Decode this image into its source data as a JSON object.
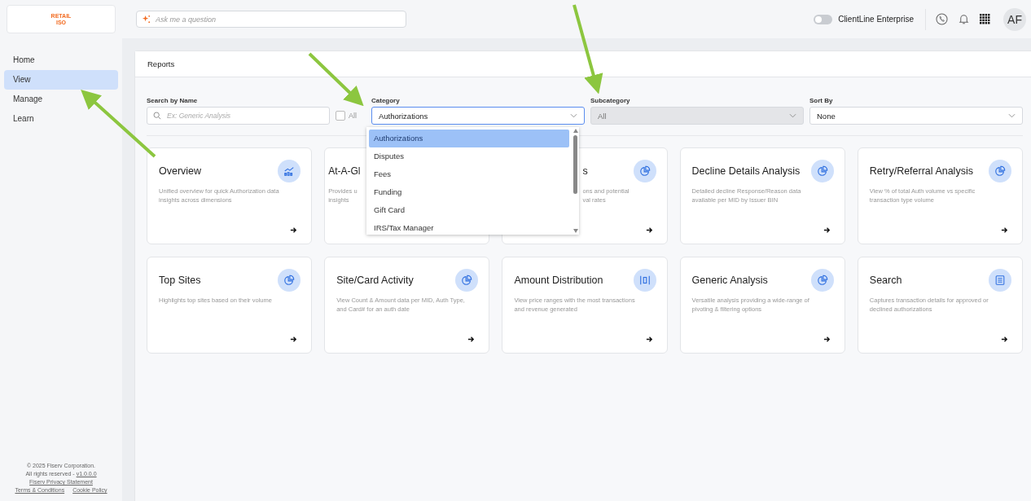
{
  "logo": {
    "line_1": "RETAIL",
    "line_2": "ISO"
  },
  "ask": {
    "placeholder": "Ask me a question"
  },
  "header": {
    "toggle": {
      "label": "ClientLine Enterprise",
      "on": false
    },
    "avatar": "AF"
  },
  "sidebar": {
    "items": [
      {
        "label": "Home",
        "selected": false
      },
      {
        "label": "View",
        "selected": true
      },
      {
        "label": "Manage",
        "selected": false
      },
      {
        "label": "Learn",
        "selected": false
      }
    ],
    "footer": {
      "copyright": "© 2025 Fiserv Corporation.",
      "rights": "All rights reserved -",
      "version": "v1.0.0.0",
      "links": [
        "Fiserv Privacy Statement",
        "Terms & Conditions",
        "Cookie Policy"
      ]
    }
  },
  "panel": {
    "title": "Reports"
  },
  "filters": {
    "search": {
      "label": "Search by Name",
      "placeholder": "Ex: Generic Analysis"
    },
    "all": {
      "label": "All",
      "checked": false
    },
    "category": {
      "label": "Category",
      "value": "Authorizations",
      "disabled": false
    },
    "subcategory": {
      "label": "Subcategory",
      "value": "All",
      "disabled": true
    },
    "sort": {
      "label": "Sort By",
      "value": "None",
      "disabled": false
    }
  },
  "category_dropdown": {
    "options": [
      {
        "label": "Authorizations",
        "selected": true
      },
      {
        "label": "Disputes",
        "selected": false
      },
      {
        "label": "Fees",
        "selected": false
      },
      {
        "label": "Funding",
        "selected": false
      },
      {
        "label": "Gift Card",
        "selected": false
      },
      {
        "label": "IRS/Tax Manager",
        "selected": false
      }
    ]
  },
  "cards": [
    {
      "title": "Overview",
      "description": [
        "Unified overview for quick Authorization data",
        "insights across dimensions"
      ]
    },
    {
      "title": "At-A-Gl",
      "description": [
        "Provides u",
        "insights"
      ]
    },
    {
      "title": "s",
      "description": [
        "ons and potential",
        "val rates"
      ]
    },
    {
      "title": "Decline Details Analysis",
      "description": [
        "Detailed decline Response/Reason data",
        "available per MID by Issuer BIN"
      ]
    },
    {
      "title": "Retry/Referral Analysis",
      "description": [
        "View % of total Auth volume vs specific",
        "transaction type volume"
      ]
    },
    {
      "title": "Top Sites",
      "description": [
        "Highlights top sites based on their volume"
      ]
    },
    {
      "title": "Site/Card Activity",
      "description": [
        "View Count & Amount data per MID, Auth Type,",
        "and Card# for an auth date"
      ]
    },
    {
      "title": "Amount Distribution",
      "description": [
        "View price ranges with the most transactions",
        "and revenue generated"
      ]
    },
    {
      "title": "Generic Analysis",
      "description": [
        "Versatile analysis providing a wide-range of",
        "pivoting & filtering options"
      ]
    },
    {
      "title": "Search",
      "description": [
        "Captures transaction details for approved or",
        "declined authorizations"
      ]
    }
  ]
}
